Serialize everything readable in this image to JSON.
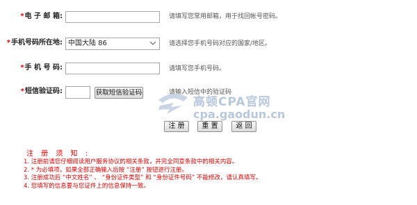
{
  "form": {
    "email": {
      "required_mark": "*",
      "label": "电 子 邮 箱:",
      "value": "",
      "hint": "请填写您常用邮箱，用于找回帐号密码。"
    },
    "region": {
      "required_mark": "*",
      "label": "手机号码所在地:",
      "value": "中国大陆 86",
      "hint": "请选择您手机号码对应的国家/地区。"
    },
    "phone": {
      "required_mark": "*",
      "label": "手 机 号 码:",
      "value": "",
      "hint": "请填写您手机号码。"
    },
    "sms_code": {
      "required_mark": "*",
      "label": "短信验证码:",
      "value": "",
      "button": "获取短信验证码",
      "hint": "请输入短信中的验证码"
    }
  },
  "actions": {
    "register": "注 册",
    "reset": "重 置",
    "back": "返 回"
  },
  "watermark": {
    "title": "高顿CPA官网",
    "url": "cpa.gaodun.cn",
    "color": "#b8c8dc"
  },
  "notice": {
    "title": "注 册 须 知 :",
    "items": [
      "1. 注册前请您仔细阅读用户服务协议的相关条款，并完全同意条款中的相关内容。",
      "2. * 为必填项，如果全部正确输入后按 “注册” 按钮进行注册。",
      "3. 注册成功后 “中文姓名” 、 “身份证件类型” 和 “身份证件号码” 不能修改，请认真填写。",
      "4. 您填写的信息要与您证件上的信息保持一致。"
    ],
    "color": "#e60000"
  }
}
